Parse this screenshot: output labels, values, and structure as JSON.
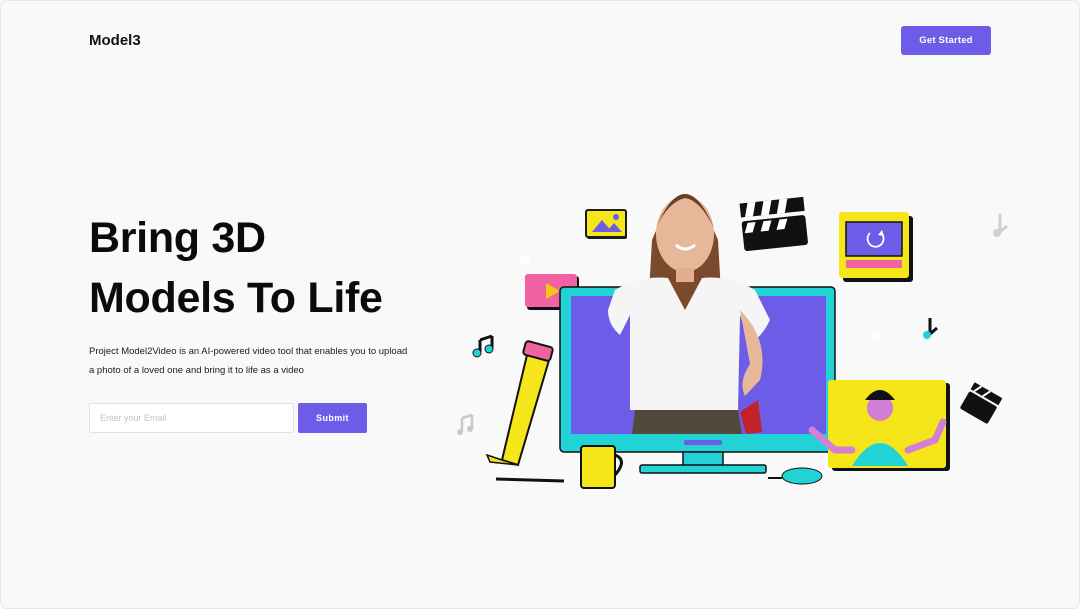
{
  "header": {
    "logo": "Model3",
    "cta_label": "Get Started"
  },
  "hero": {
    "headline_line1": "Bring 3D",
    "headline_line2": "Models To Life",
    "description": "Project Model2Video is an AI-powered video tool that enables you to upload a photo of a loved one and bring it to life as a video"
  },
  "signup": {
    "email_placeholder": "Enter your Email",
    "email_value": "",
    "submit_label": "Submit"
  },
  "colors": {
    "accent": "#6c5ce7",
    "monitor_frame": "#22d3d6",
    "yellow": "#f5e61a",
    "pink": "#f062a2",
    "background": "#f9f9fa"
  },
  "illustration": {
    "icons": [
      "image-icon",
      "clapperboard-icon",
      "video-player-icon",
      "play-icon",
      "music-note-icon",
      "pencil-icon",
      "mug-icon",
      "mouse-icon",
      "monitor-icon",
      "avatar-person-icon"
    ]
  }
}
